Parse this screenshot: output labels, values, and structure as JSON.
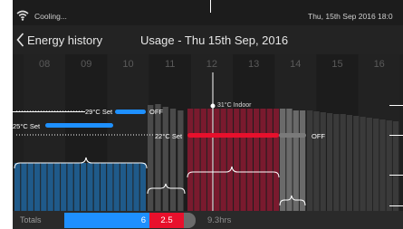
{
  "status": {
    "text": "Cooling...",
    "datetime": "Thu, 15th Sep 2016  18:0"
  },
  "header": {
    "back_label": "Energy history",
    "title": "Usage - Thu 15th Sep, 2016"
  },
  "chart": {
    "hours": [
      "08",
      "09",
      "10",
      "11",
      "12",
      "13",
      "14",
      "15",
      "16"
    ],
    "labels": {
      "set_29": "29°C Set",
      "off_1": "OFF",
      "set_25": "25°C Set",
      "set_22": "22°C Set",
      "off_2": "OFF",
      "indoor": "31°C Indoor"
    }
  },
  "totals": {
    "label": "Totals",
    "cooling": "6",
    "heating": "2.5",
    "hours": "9.3hrs"
  },
  "colors": {
    "cooling": "#1e90ff",
    "heating": "#e8102c",
    "fan": "#6b6b6b",
    "bars_blue": "#1f5a8a",
    "bars_red": "#7a1a2e",
    "bars_grey": "#555555"
  }
}
